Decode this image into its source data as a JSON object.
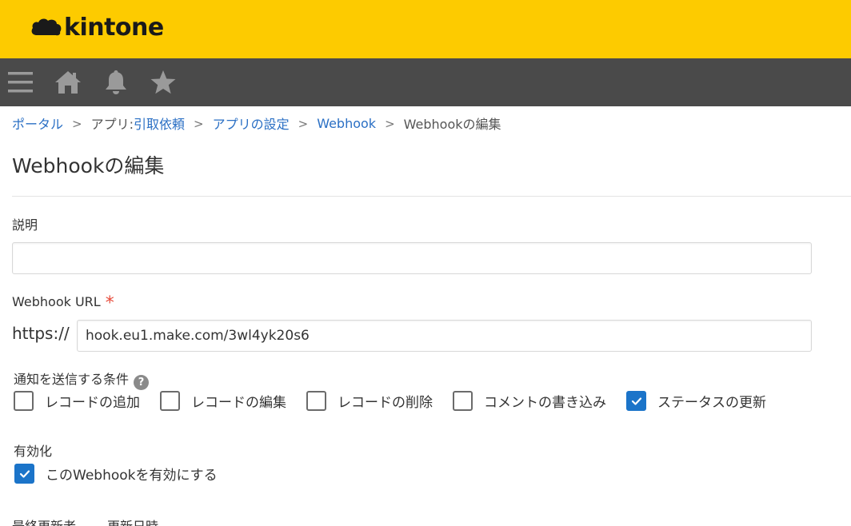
{
  "header": {
    "logo_text": "kintone",
    "brand_color": "#fdcb00"
  },
  "navbar": {
    "bg_color": "#4a4a4a",
    "icons": [
      "menu-icon",
      "home-icon",
      "bell-icon",
      "star-icon"
    ]
  },
  "breadcrumb": {
    "items": [
      {
        "label": "ポータル",
        "link": true
      },
      {
        "label": "アプリ: ",
        "link": false
      },
      {
        "label": "引取依頼",
        "link": true
      },
      {
        "label": "アプリの設定",
        "link": true
      },
      {
        "label": "Webhook",
        "link": true
      },
      {
        "label": "Webhookの編集",
        "link": false
      }
    ],
    "separator": ">"
  },
  "page": {
    "title": "Webhookの編集"
  },
  "form": {
    "description_label": "説明",
    "description_value": "",
    "url_label": "Webhook URL",
    "required_mark": "*",
    "url_prefix": "https://",
    "url_value": "hook.eu1.make.com/3wl4yk20s6",
    "conditions_label": "通知を送信する条件",
    "help_mark": "?",
    "conditions": [
      {
        "label": "レコードの追加",
        "checked": false
      },
      {
        "label": "レコードの編集",
        "checked": false
      },
      {
        "label": "レコードの削除",
        "checked": false
      },
      {
        "label": "コメントの書き込み",
        "checked": false
      },
      {
        "label": "ステータスの更新",
        "checked": true
      }
    ],
    "enable_label": "有効化",
    "enable_checkbox_label": "このWebhookを有効にする",
    "enable_checked": true,
    "footer_labels": [
      "最終更新者",
      "更新日時"
    ]
  },
  "colors": {
    "link": "#2a6fc4",
    "checkbox_checked": "#1b74c9",
    "required": "#e74c3c"
  }
}
